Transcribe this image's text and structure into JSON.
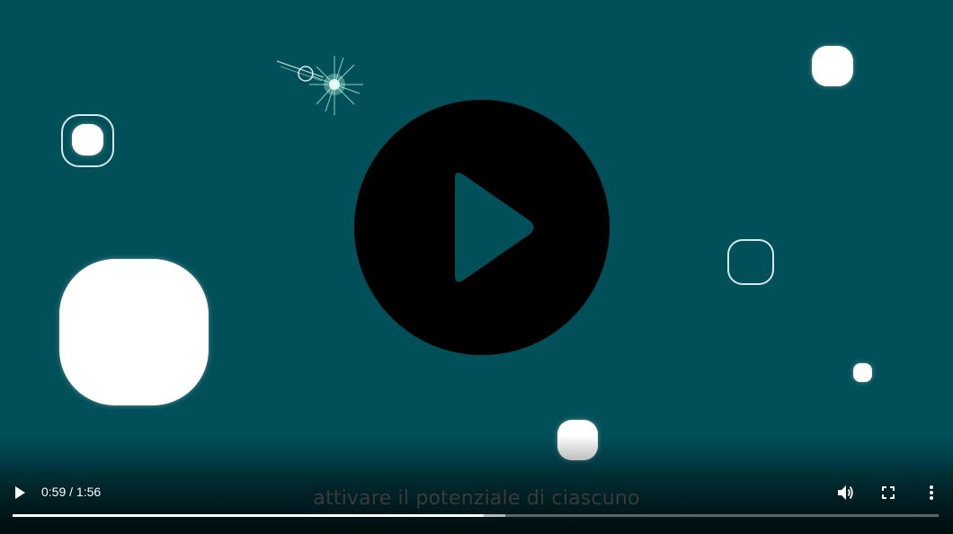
{
  "player": {
    "current_time": "0:59",
    "separator": " / ",
    "duration": "1:56",
    "subtitle": "attivare il potenziale di ciascuno",
    "progress_fraction": 0.5086,
    "buffered_fraction": 0.532,
    "background_color": "#00505a"
  },
  "icons": {
    "big_play": "play-icon",
    "small_play": "play-icon",
    "volume": "volume-icon",
    "fullscreen": "fullscreen-icon",
    "more": "more-vertical-icon"
  }
}
